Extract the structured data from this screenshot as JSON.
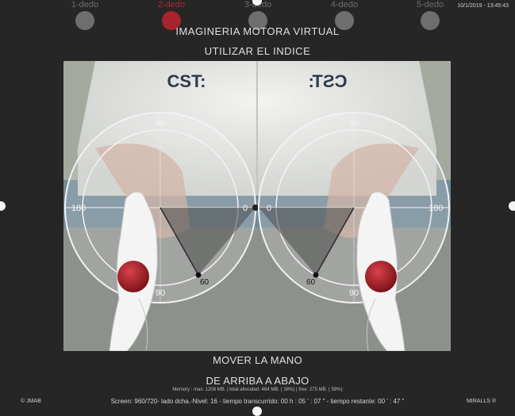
{
  "fingers": [
    {
      "label": "1-dedo",
      "active": false
    },
    {
      "label": "2-dedo",
      "active": true
    },
    {
      "label": "3-dedo",
      "active": false
    },
    {
      "label": "4-dedo",
      "active": false
    },
    {
      "label": "5-dedo",
      "active": false
    }
  ],
  "timestamp": "10/1/2019 - 13:45:43",
  "title": "IMAGINERIA MOTORA VIRTUAL",
  "instruction_top": "UTILIZAR EL INDICE",
  "instruction_bottom_1": "MOVER LA MANO",
  "instruction_bottom_2": "DE ARRIBA A ABAJO",
  "memory_line": "Memory : max: 1208 MB. | total allocated: 464 MB. ( 38%) | free: 275 MB. ( 59%)",
  "copyright": "© JMAB",
  "brand": "MIRALLS ®",
  "status_line": "Screen: 960/720- lado dcha.-Nivel: 16 - tiempo transcurrido: 00 h : 05 ' : 07 \" - tiempo restante: 00 ' : 47 \"",
  "shirt_logo_left": "CST:",
  "shirt_logo_right": "CST:",
  "protractor_labels": {
    "top": "90",
    "bottom": "90",
    "outer": "180",
    "inner": "0",
    "marker": "60"
  },
  "colors": {
    "background": "#262626",
    "active_finger": "#a8232c",
    "inactive_finger": "#6e6e6e",
    "target_dot": "#a8232c"
  }
}
